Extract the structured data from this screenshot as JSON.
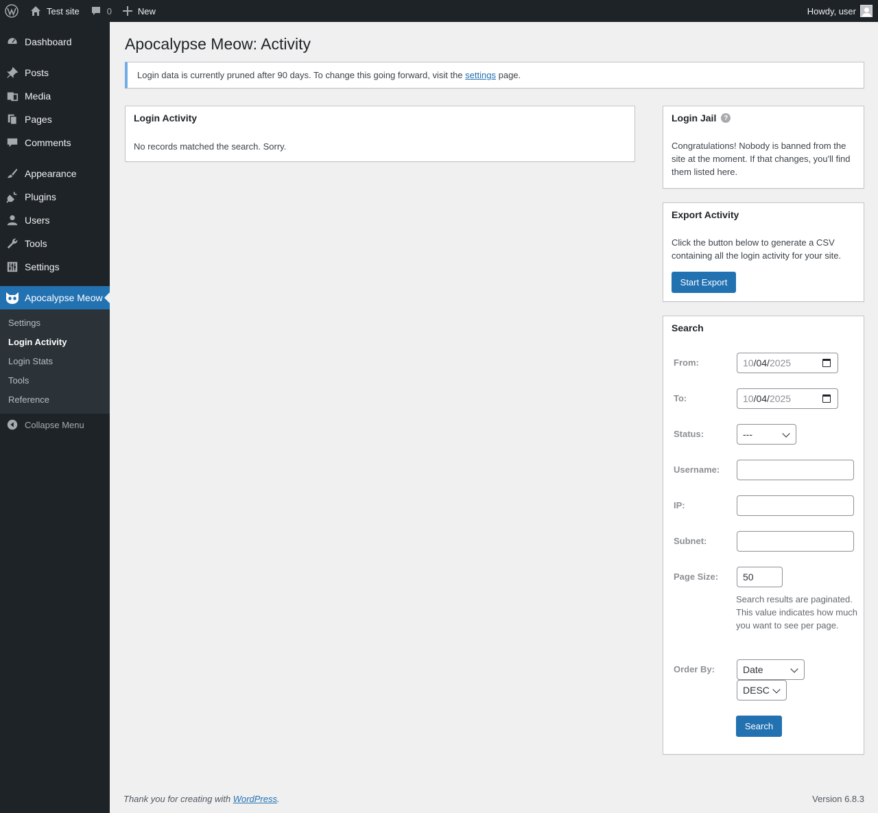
{
  "adminbar": {
    "site_name": "Test site",
    "comments_count": "0",
    "new_label": "New",
    "greeting": "Howdy, user"
  },
  "sidebar": {
    "items": [
      {
        "label": "Dashboard",
        "icon": "dashboard-icon"
      },
      {
        "label": "Posts",
        "icon": "pin-icon"
      },
      {
        "label": "Media",
        "icon": "media-icon"
      },
      {
        "label": "Pages",
        "icon": "pages-icon"
      },
      {
        "label": "Comments",
        "icon": "comment-icon"
      },
      {
        "label": "Appearance",
        "icon": "brush-icon"
      },
      {
        "label": "Plugins",
        "icon": "plug-icon"
      },
      {
        "label": "Users",
        "icon": "user-icon"
      },
      {
        "label": "Tools",
        "icon": "wrench-icon"
      },
      {
        "label": "Settings",
        "icon": "sliders-icon"
      },
      {
        "label": "Apocalypse Meow",
        "icon": "cat-icon"
      }
    ],
    "submenu": [
      "Settings",
      "Login Activity",
      "Login Stats",
      "Tools",
      "Reference"
    ],
    "collapse_label": "Collapse Menu"
  },
  "page": {
    "title": "Apocalypse Meow: Activity",
    "notice_before": "Login data is currently pruned after 90 days. To change this going forward, visit the",
    "notice_link": "settings",
    "notice_after": "page."
  },
  "login_activity": {
    "title": "Login Activity",
    "empty_message": "No records matched the search. Sorry."
  },
  "login_jail": {
    "title": "Login Jail",
    "message": "Congratulations! Nobody is banned from the site at the moment. If that changes, you'll find them listed here."
  },
  "export": {
    "title": "Export Activity",
    "message": "Click the button below to generate a CSV containing all the login activity for your site.",
    "button": "Start Export"
  },
  "search": {
    "title": "Search",
    "from_label": "From:",
    "from_value": {
      "month": "10",
      "day": "04",
      "year": "2025"
    },
    "to_label": "To:",
    "to_value": {
      "month": "10",
      "day": "04",
      "year": "2025"
    },
    "status_label": "Status:",
    "status_value": "---",
    "username_label": "Username:",
    "ip_label": "IP:",
    "subnet_label": "Subnet:",
    "page_size_label": "Page Size:",
    "page_size_value": "50",
    "page_size_desc": "Search results are paginated. This value indicates how much you want to see per page.",
    "order_by_label": "Order By:",
    "order_by_value": "Date",
    "order_dir_value": "DESC",
    "button": "Search"
  },
  "footer": {
    "before": "Thank you for creating with",
    "link": "WordPress",
    "after": ".",
    "version": "Version 6.8.3"
  }
}
